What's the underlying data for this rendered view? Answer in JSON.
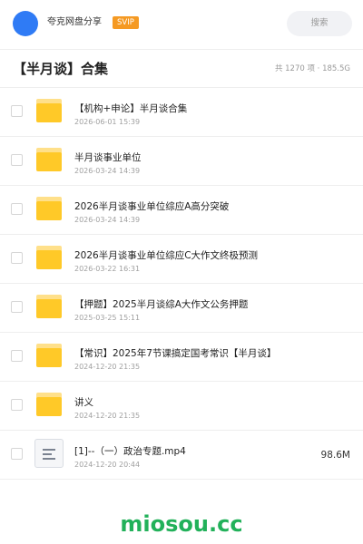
{
  "header": {
    "app_name": "夸克网盘分享",
    "vip_label": "SVIP",
    "search_placeholder": "搜索"
  },
  "folder": {
    "title": "【半月谈】合集",
    "summary": "共 1270 项 · 185.5G"
  },
  "items": [
    {
      "type": "folder",
      "name": "【机构+申论】半月谈合集",
      "date": "2026-06-01 15:39",
      "size": ""
    },
    {
      "type": "folder",
      "name": "半月谈事业单位",
      "date": "2026-03-24 14:39",
      "size": ""
    },
    {
      "type": "folder",
      "name": "2026半月谈事业单位综应A高分突破",
      "date": "2026-03-24 14:39",
      "size": ""
    },
    {
      "type": "folder",
      "name": "2026半月谈事业单位综应C大作文终极预测",
      "date": "2026-03-22 16:31",
      "size": ""
    },
    {
      "type": "folder",
      "name": "【押题】2025半月谈综A大作文公务押题",
      "date": "2025-03-25 15:11",
      "size": ""
    },
    {
      "type": "folder",
      "name": "【常识】2025年7节课搞定国考常识【半月谈】",
      "date": "2024-12-20 21:35",
      "size": ""
    },
    {
      "type": "folder",
      "name": "讲义",
      "date": "2024-12-20 21:35",
      "size": ""
    },
    {
      "type": "file",
      "name": "[1]--（一）政治专题.mp4",
      "date": "2024-12-20 20:44",
      "size": "98.6M"
    }
  ],
  "footer": {
    "watermark": "miosou.cc"
  },
  "colors": {
    "avatar": "#2f7bf5",
    "vip": "#f59a23",
    "folder": "#ffc928",
    "watermark": "#22b15a"
  }
}
